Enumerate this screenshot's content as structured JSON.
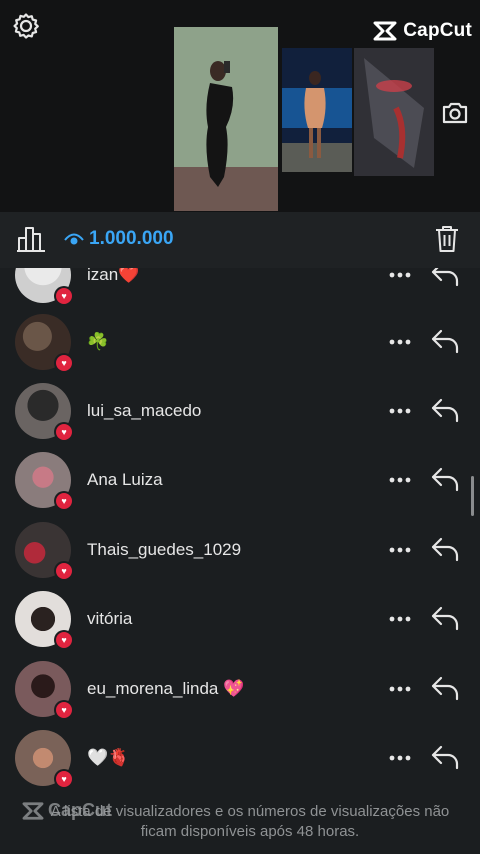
{
  "watermark": {
    "brand": "CapCut"
  },
  "header": {
    "view_count": "1.000.000"
  },
  "viewers": [
    {
      "name": "izan",
      "emoji": "❤️",
      "avatar_tone": "#d9d9d9"
    },
    {
      "name": "☘️",
      "emoji": "",
      "avatar_tone": "#4a3a32"
    },
    {
      "name": "lui_sa_macedo",
      "emoji": "",
      "avatar_tone": "#5a5452"
    },
    {
      "name": "Ana Luiza",
      "emoji": "",
      "avatar_tone": "#9a8a8a"
    },
    {
      "name": "Thais_guedes_1029",
      "emoji": "",
      "avatar_tone": "#6a3a3a"
    },
    {
      "name": "vitória",
      "emoji": "",
      "avatar_tone": "#e4e0dc"
    },
    {
      "name": "eu_morena_linda",
      "emoji": "💖",
      "avatar_tone": "#7a5a5c"
    },
    {
      "name": "🤍🫀",
      "emoji": "",
      "avatar_tone": "#8a7064"
    }
  ],
  "footer": {
    "notice": "A lista de visualizadores e os números de visualizações não ficam disponíveis após 48 horas."
  },
  "colors": {
    "accent": "#3aa6f5",
    "heart": "#e0243f",
    "background": "#1b1e20"
  }
}
